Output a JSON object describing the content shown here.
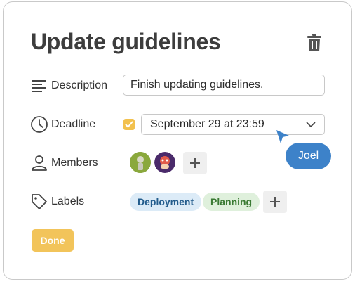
{
  "card": {
    "title": "Update guidelines"
  },
  "description": {
    "label": "Description",
    "value": "Finish updating guidelines.",
    "icon": "text-lines-icon"
  },
  "deadline": {
    "label": "Deadline",
    "checked": true,
    "value": "September 29 at 23:59",
    "icon": "clock-icon"
  },
  "members": {
    "label": "Members",
    "icon": "person-icon",
    "avatars": [
      "avatar-green",
      "avatar-purple"
    ]
  },
  "labels": {
    "label": "Labels",
    "icon": "tag-icon",
    "chips": [
      "Deployment",
      "Planning"
    ]
  },
  "collaborator": {
    "name": "Joel"
  },
  "actions": {
    "done_label": "Done"
  },
  "colors": {
    "accent_yellow": "#f2c45a",
    "collaborator_blue": "#3d82c9",
    "chip_blue_bg": "#dcebf7",
    "chip_green_bg": "#dff0dc"
  }
}
